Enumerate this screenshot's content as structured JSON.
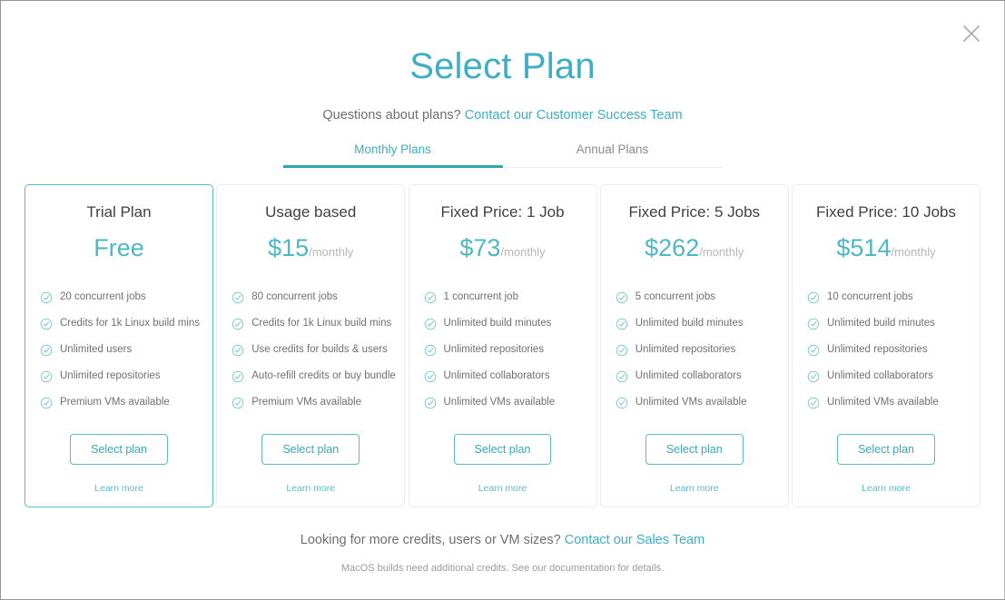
{
  "modal": {
    "close_icon": "close-icon"
  },
  "header": {
    "title": "Select Plan",
    "subtitle_prefix": "Questions about plans? ",
    "subtitle_link": "Contact our Customer Success Team"
  },
  "tabs": [
    {
      "label": "Monthly Plans",
      "active": true
    },
    {
      "label": "Annual Plans",
      "active": false
    }
  ],
  "plans": [
    {
      "name": "Trial Plan",
      "price": "Free",
      "period": "",
      "selected": true,
      "features": [
        "20 concurrent jobs",
        "Credits for 1k Linux build mins",
        "Unlimited users",
        "Unlimited repositories",
        "Premium VMs available"
      ],
      "select_label": "Select plan",
      "learn_more_label": "Learn more"
    },
    {
      "name": "Usage based",
      "price": "$15",
      "period": "/monthly",
      "selected": false,
      "features": [
        "80 concurrent jobs",
        "Credits for 1k Linux build mins",
        "Use credits for builds & users",
        "Auto-refill credits or buy bundle",
        "Premium VMs available"
      ],
      "select_label": "Select plan",
      "learn_more_label": "Learn more"
    },
    {
      "name": "Fixed Price: 1 Job",
      "price": "$73",
      "period": "/monthly",
      "selected": false,
      "features": [
        "1 concurrent job",
        "Unlimited build minutes",
        "Unlimited repositories",
        "Unlimited collaborators",
        "Unlimited VMs available"
      ],
      "select_label": "Select plan",
      "learn_more_label": "Learn more"
    },
    {
      "name": "Fixed Price: 5 Jobs",
      "price": "$262",
      "period": "/monthly",
      "selected": false,
      "features": [
        "5 concurrent jobs",
        "Unlimited build minutes",
        "Unlimited repositories",
        "Unlimited collaborators",
        "Unlimited VMs available"
      ],
      "select_label": "Select plan",
      "learn_more_label": "Learn more"
    },
    {
      "name": "Fixed Price: 10 Jobs",
      "price": "$514",
      "period": "/monthly",
      "selected": false,
      "features": [
        "10 concurrent jobs",
        "Unlimited build minutes",
        "Unlimited repositories",
        "Unlimited collaborators",
        "Unlimited VMs available"
      ],
      "select_label": "Select plan",
      "learn_more_label": "Learn more"
    }
  ],
  "footer": {
    "main_prefix": "Looking for more credits, users or VM sizes? ",
    "main_link": "Contact our Sales Team",
    "note": "MacOS builds need additional credits. See our documentation for details."
  },
  "colors": {
    "accent": "#3eaec4",
    "accent_dark": "#2fa8ac",
    "text": "#6e6e6e",
    "title": "#414141",
    "muted": "#9b9b9b"
  }
}
